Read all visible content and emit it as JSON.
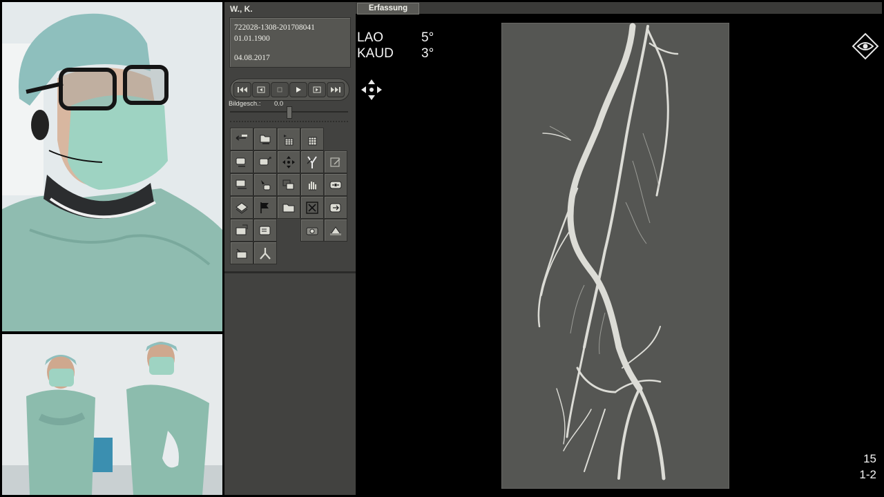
{
  "patient": {
    "name": "W., K.",
    "id": "722028-1308-201708041",
    "birth_date": "01.01.1900",
    "study_date": "04.08.2017"
  },
  "playback": {
    "speed_label": "Bildgesch.:",
    "speed_value": "0.0"
  },
  "viewer": {
    "tab_label": "Erfassung",
    "angle_1_label": "LAO",
    "angle_1_value": "5°",
    "angle_2_label": "KAUD",
    "angle_2_value": "3°",
    "frame_number": "15",
    "series_number": "1-2"
  },
  "icons": {
    "transport": [
      "skip-to-start-icon",
      "step-back-icon",
      "stop-icon",
      "play-icon",
      "step-forward-icon",
      "skip-to-end-icon"
    ],
    "viewer": [
      "pan-move-icon",
      "eye-view-icon"
    ]
  },
  "colors": {
    "panel_bg": "#424240",
    "viewer_bg": "#000000",
    "angio_bg": "#555653",
    "vessel": "#dcdcd6"
  }
}
